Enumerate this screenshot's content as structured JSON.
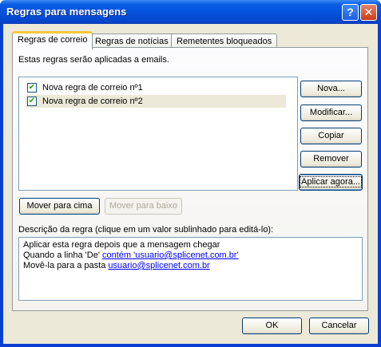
{
  "window": {
    "title": "Regras para mensagens",
    "help_label": "?",
    "close_label": "✕"
  },
  "tabs": [
    {
      "label": "Regras de correio",
      "active": true
    },
    {
      "label": "Regras de notícias",
      "active": false
    },
    {
      "label": "Remetentes bloqueados",
      "active": false
    }
  ],
  "intro_text": "Estas regras serão aplicadas a emails.",
  "rules": [
    {
      "label": "Nova regra de correio nº1",
      "checked": true
    },
    {
      "label": "Nova regra de correio nº2",
      "checked": true
    }
  ],
  "buttons": {
    "new": "Nova...",
    "modify": "Modificar...",
    "copy": "Copiar",
    "remove": "Remover",
    "apply_now": "Aplicar agora...",
    "move_up": "Mover para cima",
    "move_down": "Mover para baixo",
    "ok": "OK",
    "cancel": "Cancelar"
  },
  "description": {
    "label": "Descrição da regra (clique em um valor sublinhado para editá-lo):",
    "line1": "Aplicar esta regra depois que a mensagem chegar",
    "line2_prefix": "Quando a linha 'De' ",
    "line2_link": "contém 'usuario@splicenet.com.br'",
    "line3_prefix": "Movê-la para a pasta ",
    "line3_link": "usuario@splicenet.com.br"
  },
  "colors": {
    "titlebar": "#0653de",
    "tab_highlight": "#ffc83c",
    "link": "#0000ff"
  }
}
